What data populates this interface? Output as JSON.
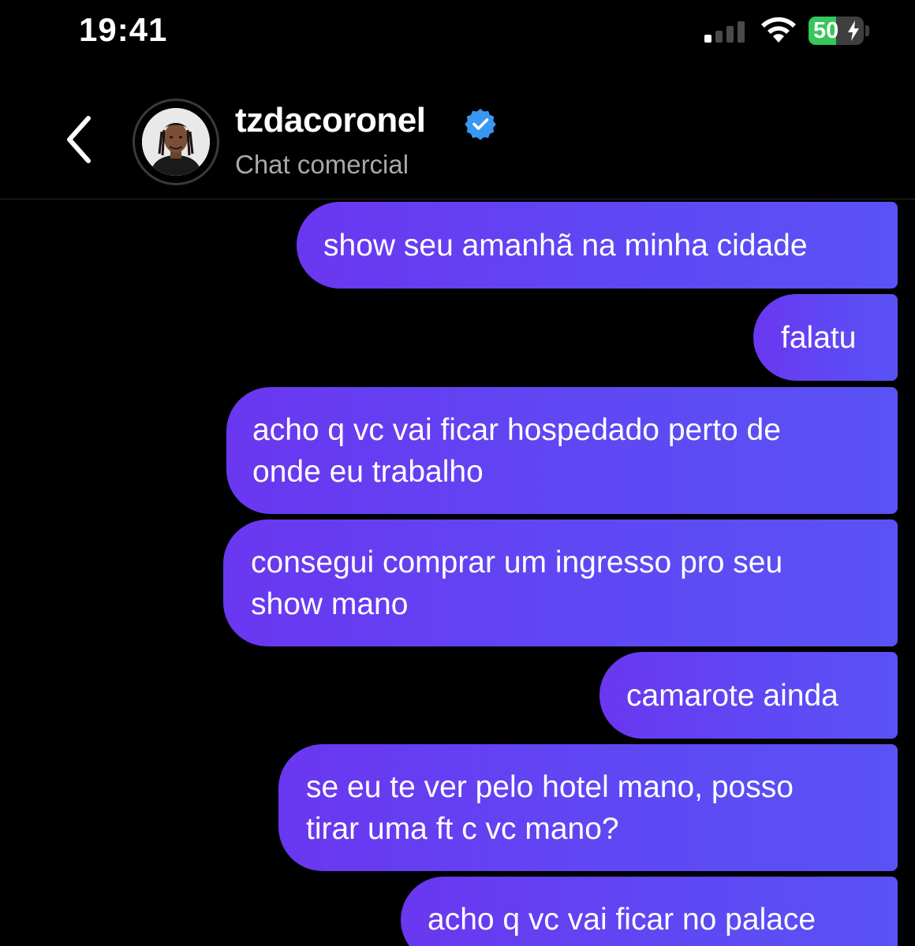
{
  "status_bar": {
    "time": "19:41",
    "battery_percent": "50",
    "battery_level": 0.5,
    "charging": true
  },
  "header": {
    "name": "tzdacoronel",
    "subtitle": "Chat comercial",
    "verified": true
  },
  "messages": [
    {
      "text": "show seu amanhã na minha cidade"
    },
    {
      "text": "falatu"
    },
    {
      "text": "acho q vc vai ficar hospedado perto de\nonde eu trabalho"
    },
    {
      "text": "consegui comprar um ingresso pro seu\nshow mano"
    },
    {
      "text": "camarote ainda"
    },
    {
      "text": "se eu te ver pelo hotel mano, posso\ntirar uma ft c vc mano?"
    },
    {
      "text": "acho q vc vai ficar no palace"
    }
  ],
  "colors": {
    "bubble_start": "#6a37f0",
    "bubble_end": "#5a52f5",
    "verified_badge": "#3897f0",
    "battery_green": "#34c759"
  }
}
